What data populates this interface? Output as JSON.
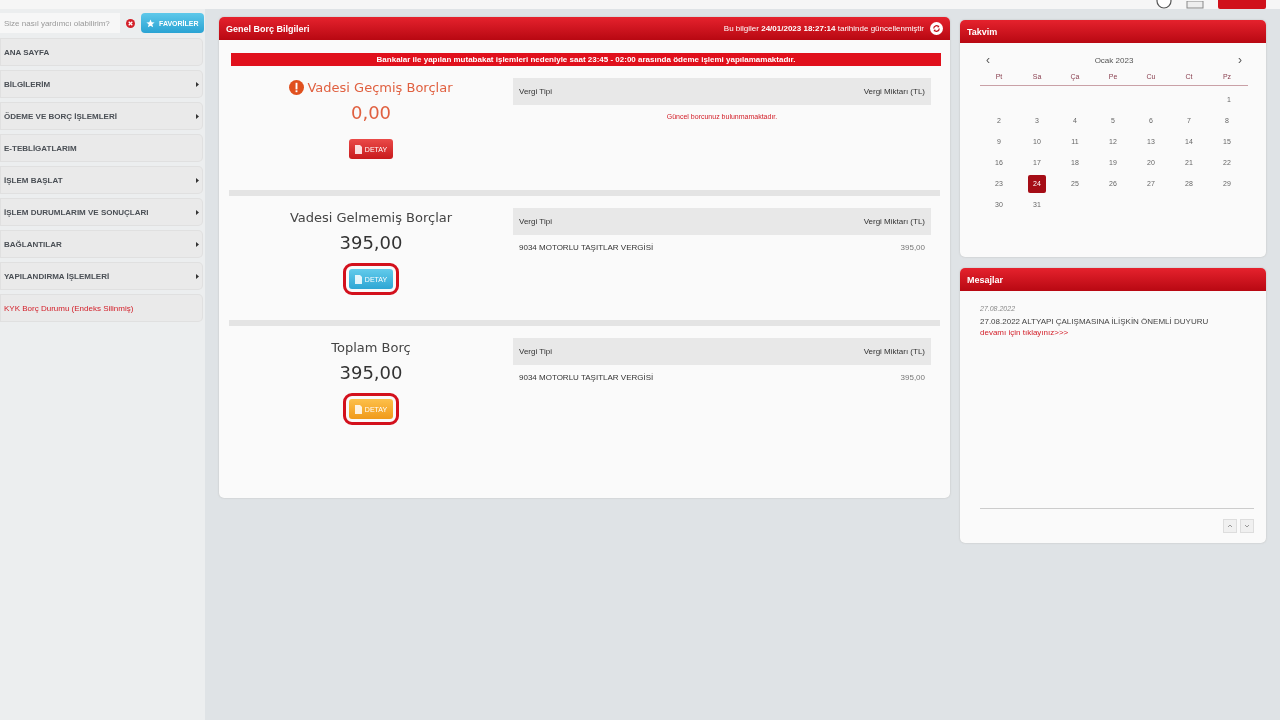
{
  "sidebar": {
    "search": {
      "placeholder": "Size nasıl yardımcı olabilirim?"
    },
    "favorites_button": "FAVORİLER",
    "items": [
      {
        "label": "ANA SAYFA",
        "has_submenu": false,
        "kind": "normal"
      },
      {
        "label": "BİLGİLERİM",
        "has_submenu": true,
        "kind": "normal"
      },
      {
        "label": "ÖDEME VE BORÇ İŞLEMLERİ",
        "has_submenu": true,
        "kind": "normal"
      },
      {
        "label": "E-TEBLİGATLARIM",
        "has_submenu": false,
        "kind": "normal"
      },
      {
        "label": "İŞLEM BAŞLAT",
        "has_submenu": true,
        "kind": "normal"
      },
      {
        "label": "İŞLEM DURUMLARIM VE SONUÇLARI",
        "has_submenu": true,
        "kind": "normal"
      },
      {
        "label": "BAĞLANTILAR",
        "has_submenu": true,
        "kind": "normal"
      },
      {
        "label": "YAPILANDIRMA İŞLEMLERİ",
        "has_submenu": true,
        "kind": "normal"
      },
      {
        "label": "KYK Borç Durumu (Endeks Silinmiş)",
        "has_submenu": false,
        "kind": "alert"
      }
    ]
  },
  "debt_panel": {
    "title": "Genel Borç Bilgileri",
    "updated_prefix": "Bu bilgiler ",
    "updated_time": "24/01/2023 18:27:14",
    "updated_suffix": " tarihinde güncellenmiştir",
    "notice": "Bankalar ile yapılan mutabakat işlemleri nedeniyle saat 23:45 - 02:00 arasında ödeme işlemi yapılamamaktadır.",
    "sections": [
      {
        "title": "Vadesi Geçmiş Borçlar",
        "amount": "0,00",
        "kind": "overdue",
        "button": "DETAY",
        "highlighted": false,
        "columns": [
          "Vergi Tipi",
          "Vergi Miktarı (TL)"
        ],
        "empty_message": "Güncel borcunuz bulunmamaktadır."
      },
      {
        "title": "Vadesi Gelmemiş Borçlar",
        "amount": "395,00",
        "kind": "upcoming",
        "button": "DETAY",
        "highlighted": true,
        "columns": [
          "Vergi Tipi",
          "Vergi Miktarı (TL)"
        ],
        "rows": [
          [
            "9034 MOTORLU TAŞITLAR VERGİSİ",
            "395,00"
          ]
        ]
      },
      {
        "title": "Toplam Borç",
        "amount": "395,00",
        "kind": "total",
        "button": "DETAY",
        "highlighted": true,
        "columns": [
          "Vergi Tipi",
          "Vergi Miktarı (TL)"
        ],
        "rows": [
          [
            "9034 MOTORLU TAŞITLAR VERGİSİ",
            "395,00"
          ]
        ]
      }
    ]
  },
  "calendar": {
    "title": "Takvim",
    "prev": "‹",
    "month": "Ocak 2023",
    "next": "›",
    "weekdays": [
      "Pt",
      "Sa",
      "Ça",
      "Pe",
      "Cu",
      "Ct",
      "Pz"
    ],
    "weeks": [
      [
        {
          "day": "1",
          "selected": false
        }
      ],
      [
        {
          "day": "2",
          "selected": false
        },
        {
          "day": "3",
          "selected": false
        },
        {
          "day": "4",
          "selected": false
        },
        {
          "day": "5",
          "selected": false
        },
        {
          "day": "6",
          "selected": false
        },
        {
          "day": "7",
          "selected": false
        },
        {
          "day": "8",
          "selected": false
        }
      ],
      [
        {
          "day": "9",
          "selected": false
        },
        {
          "day": "10",
          "selected": false
        },
        {
          "day": "11",
          "selected": false
        },
        {
          "day": "12",
          "selected": false
        },
        {
          "day": "13",
          "selected": false
        },
        {
          "day": "14",
          "selected": false
        },
        {
          "day": "15",
          "selected": false
        }
      ],
      [
        {
          "day": "16",
          "selected": false
        },
        {
          "day": "17",
          "selected": false
        },
        {
          "day": "18",
          "selected": false
        },
        {
          "day": "19",
          "selected": false
        },
        {
          "day": "20",
          "selected": false
        },
        {
          "day": "21",
          "selected": false
        },
        {
          "day": "22",
          "selected": false
        }
      ],
      [
        {
          "day": "23",
          "selected": false
        },
        {
          "day": "24",
          "selected": true
        },
        {
          "day": "25",
          "selected": false
        },
        {
          "day": "26",
          "selected": false
        },
        {
          "day": "27",
          "selected": false
        },
        {
          "day": "28",
          "selected": false
        },
        {
          "day": "29",
          "selected": false
        }
      ],
      [
        {
          "day": "30",
          "selected": false
        },
        {
          "day": "31",
          "selected": false
        }
      ]
    ]
  },
  "messages": {
    "title": "Mesajlar",
    "items": [
      {
        "date": "27.08.2022",
        "text": "27.08.2022 ALTYAPI ÇALIŞMASINA İLİŞKİN ÖNEMLİ DUYURU ",
        "link": "devamı için tıklayınız>>>"
      }
    ]
  }
}
